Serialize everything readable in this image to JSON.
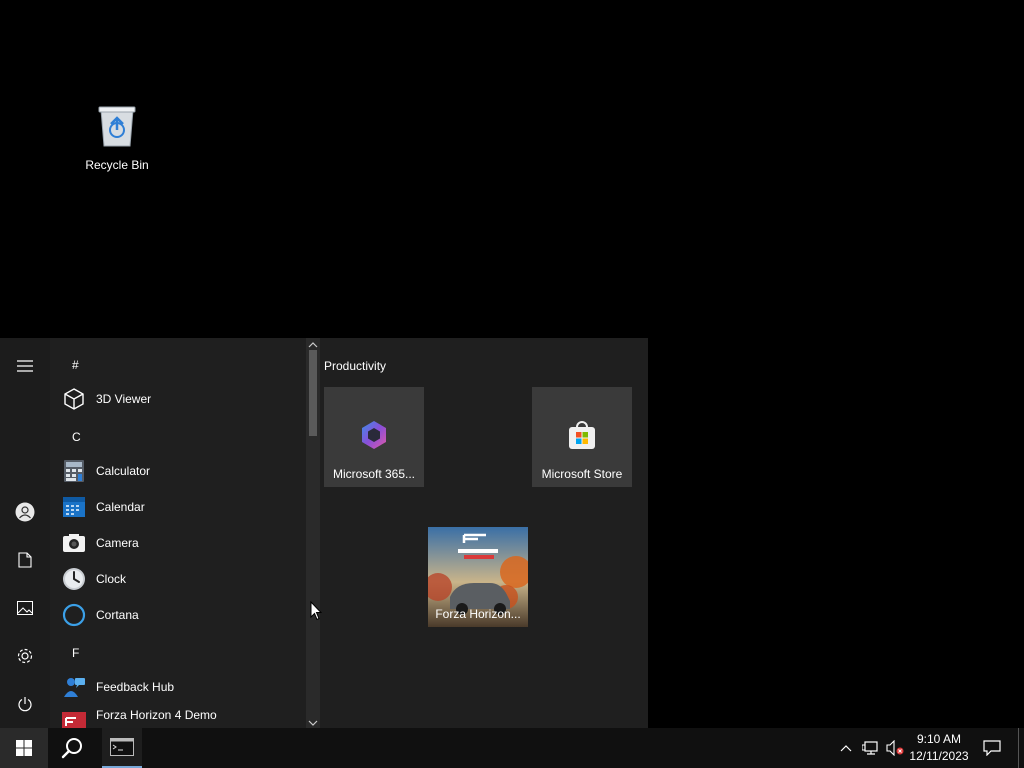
{
  "desktop": {
    "icons": [
      {
        "label": "Recycle Bin",
        "icon": "recycle-bin-icon"
      }
    ]
  },
  "start_menu": {
    "rail": [
      {
        "name": "hamburger-menu-icon"
      },
      {
        "name": "user-account-icon"
      },
      {
        "name": "documents-icon"
      },
      {
        "name": "pictures-icon"
      },
      {
        "name": "settings-icon"
      },
      {
        "name": "power-icon"
      }
    ],
    "app_list": {
      "letters": {
        "hash": "#",
        "c": "C",
        "f": "F"
      },
      "apps": [
        {
          "name": "3D Viewer",
          "icon": "3d-viewer-icon"
        },
        {
          "name": "Calculator",
          "icon": "calculator-icon"
        },
        {
          "name": "Calendar",
          "icon": "calendar-icon"
        },
        {
          "name": "Camera",
          "icon": "camera-icon"
        },
        {
          "name": "Clock",
          "icon": "clock-icon"
        },
        {
          "name": "Cortana",
          "icon": "cortana-icon"
        },
        {
          "name": "Feedback Hub",
          "icon": "feedback-hub-icon"
        },
        {
          "name": "Forza Horizon 4 Demo",
          "icon": "forza-icon"
        }
      ]
    },
    "tiles": {
      "group_title": "Productivity",
      "items": [
        {
          "label": "Microsoft 365...",
          "icon": "microsoft-365-icon"
        },
        {
          "label": "Microsoft Store",
          "icon": "microsoft-store-icon"
        },
        {
          "label": "Forza Horizon...",
          "icon": "forza-horizon-tile-image"
        }
      ]
    }
  },
  "taskbar": {
    "clock": {
      "time": "9:10 AM",
      "date": "12/11/2023"
    },
    "accent": "#78a8d8"
  }
}
